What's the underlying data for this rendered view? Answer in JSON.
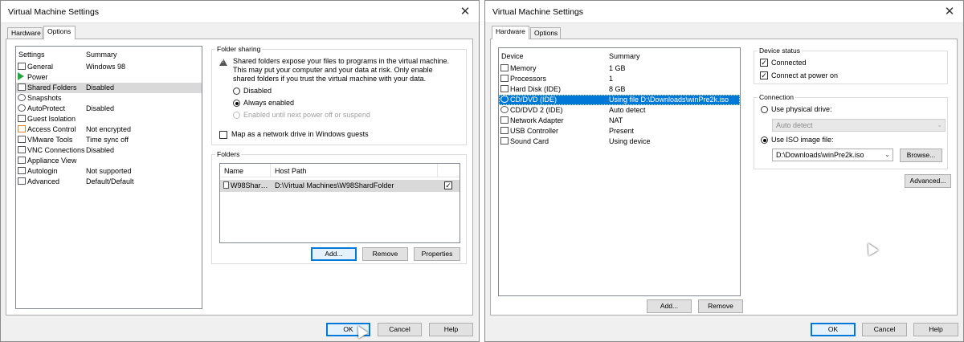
{
  "windows": [
    {
      "title": "Virtual Machine Settings",
      "close_glyph": "✕",
      "tabs": [
        {
          "label": "Hardware",
          "active": false
        },
        {
          "label": "Options",
          "active": true
        }
      ],
      "settings_list": {
        "headers": {
          "setting": "Settings",
          "summary": "Summary"
        },
        "rows": [
          {
            "setting": "General",
            "summary": "Windows 98",
            "icon": "general-icon"
          },
          {
            "setting": "Power",
            "summary": "",
            "icon": "power-icon"
          },
          {
            "setting": "Shared Folders",
            "summary": "Disabled",
            "icon": "shared-folders-icon",
            "selected": true
          },
          {
            "setting": "Snapshots",
            "summary": "",
            "icon": "snapshots-icon"
          },
          {
            "setting": "AutoProtect",
            "summary": "Disabled",
            "icon": "autoprotect-icon"
          },
          {
            "setting": "Guest Isolation",
            "summary": "",
            "icon": "guest-isolation-icon"
          },
          {
            "setting": "Access Control",
            "summary": "Not encrypted",
            "icon": "access-control-icon"
          },
          {
            "setting": "VMware Tools",
            "summary": "Time sync off",
            "icon": "vmware-tools-icon"
          },
          {
            "setting": "VNC Connections",
            "summary": "Disabled",
            "icon": "vnc-connections-icon"
          },
          {
            "setting": "Appliance View",
            "summary": "",
            "icon": "appliance-view-icon"
          },
          {
            "setting": "Autologin",
            "summary": "Not supported",
            "icon": "autologin-icon"
          },
          {
            "setting": "Advanced",
            "summary": "Default/Default",
            "icon": "advanced-icon"
          }
        ]
      },
      "folder_sharing": {
        "title": "Folder sharing",
        "warning_line1": "Shared folders expose your files to programs in the virtual machine.",
        "warning_line2": "This may put your computer and your data at risk. Only enable",
        "warning_line3": "shared folders if you trust the virtual machine with your data.",
        "opt_disabled": "Disabled",
        "opt_always": "Always enabled",
        "opt_until": "Enabled until next power off or suspend",
        "selected_option": "Always enabled",
        "map_drive_label": "Map as a network drive in Windows guests",
        "map_drive_checked": false
      },
      "folders": {
        "title": "Folders",
        "headers": {
          "name": "Name",
          "host_path": "Host Path"
        },
        "rows": [
          {
            "name": "W98Shar…",
            "host_path": "D:\\Virtual Machines\\W98ShardFolder",
            "enabled": true
          }
        ],
        "add_label": "Add...",
        "remove_label": "Remove",
        "properties_label": "Properties"
      },
      "footer": {
        "ok": "OK",
        "cancel": "Cancel",
        "help": "Help"
      }
    },
    {
      "title": "Virtual Machine Settings",
      "close_glyph": "✕",
      "tabs": [
        {
          "label": "Hardware",
          "active": true
        },
        {
          "label": "Options",
          "active": false
        }
      ],
      "device_list": {
        "headers": {
          "device": "Device",
          "summary": "Summary"
        },
        "rows": [
          {
            "device": "Memory",
            "summary": "1 GB",
            "icon": "memory-icon"
          },
          {
            "device": "Processors",
            "summary": "1",
            "icon": "processor-icon"
          },
          {
            "device": "Hard Disk (IDE)",
            "summary": "8 GB",
            "icon": "hard-disk-icon"
          },
          {
            "device": "CD/DVD (IDE)",
            "summary": "Using file D:\\Downloads\\winPre2k.iso",
            "icon": "cd-dvd-icon",
            "selected": true
          },
          {
            "device": "CD/DVD 2 (IDE)",
            "summary": "Auto detect",
            "icon": "cd-dvd-icon"
          },
          {
            "device": "Network Adapter",
            "summary": "NAT",
            "icon": "network-adapter-icon"
          },
          {
            "device": "USB Controller",
            "summary": "Present",
            "icon": "usb-controller-icon"
          },
          {
            "device": "Sound Card",
            "summary": "Using device",
            "icon": "sound-card-icon"
          }
        ],
        "add_label": "Add...",
        "remove_label": "Remove"
      },
      "device_status": {
        "title": "Device status",
        "connected_label": "Connected",
        "connected_checked": true,
        "connect_power_label": "Connect at power on",
        "connect_power_checked": true
      },
      "connection": {
        "title": "Connection",
        "physical_label": "Use physical drive:",
        "physical_value": "Auto detect",
        "iso_label": "Use ISO image file:",
        "iso_value": "D:\\Downloads\\winPre2k.iso",
        "selected_option": "Use ISO image file:",
        "browse_label": "Browse..."
      },
      "advanced_label": "Advanced...",
      "footer": {
        "ok": "OK",
        "cancel": "Cancel",
        "help": "Help"
      }
    }
  ],
  "colors": {
    "selection_blue": "#0078d7",
    "window_bg": "#f0f0f0",
    "power_green": "#27a644"
  }
}
